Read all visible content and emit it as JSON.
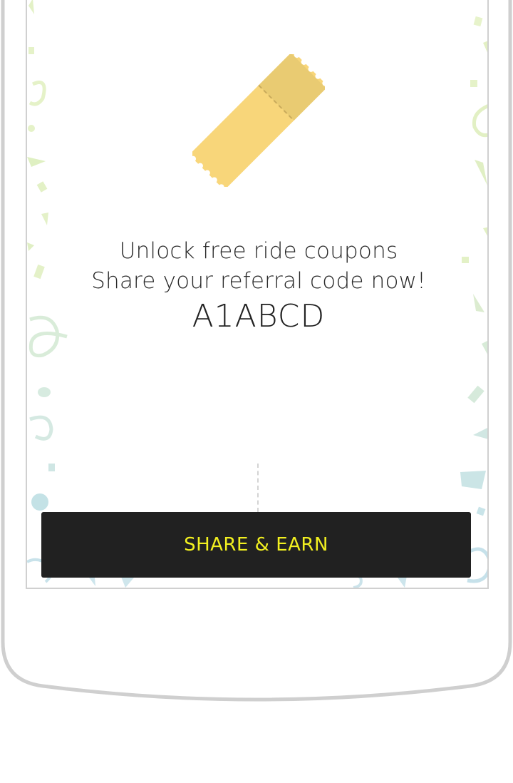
{
  "referral": {
    "headline": "Unlock free ride coupons",
    "subline": "Share your referral code now!",
    "code": "A1ABCD"
  },
  "actions": {
    "share_label": "SHARE & EARN"
  },
  "icons": {
    "hero": "coupon-ticket-icon",
    "background": "confetti-pattern"
  },
  "colors": {
    "button_background": "#212121",
    "button_text": "#f2f020",
    "ticket": "#f8d67a",
    "ticket_stub": "#e9cb72"
  }
}
